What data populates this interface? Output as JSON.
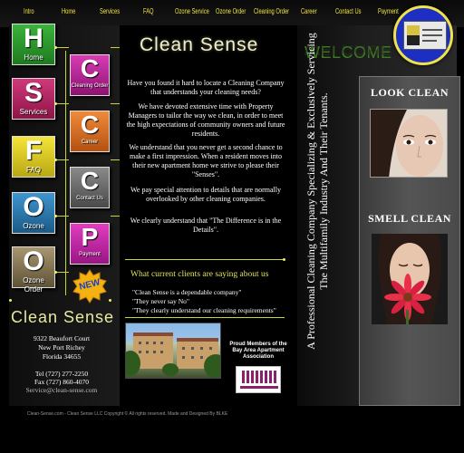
{
  "nav": {
    "items": [
      {
        "label": "Intro"
      },
      {
        "label": "Home"
      },
      {
        "label": "Services"
      },
      {
        "label": "FAQ"
      },
      {
        "label": "Ozone Service"
      },
      {
        "label": "Ozone Order"
      },
      {
        "label": "Cleaning Order"
      },
      {
        "label": "Career"
      },
      {
        "label": "Contact Us"
      },
      {
        "label": "Payment"
      }
    ]
  },
  "tiles": {
    "home": {
      "letter": "H",
      "label": "Home",
      "color": "#2a9a2a"
    },
    "cleaning_order": {
      "letter": "C",
      "label": "Cleaning Order",
      "color": "#b01f8f"
    },
    "services": {
      "letter": "S",
      "label": "Services",
      "color": "#b2205e"
    },
    "career": {
      "letter": "C",
      "label": "Career",
      "color": "#d86a1c"
    },
    "faq": {
      "letter": "F",
      "label": "FAQ",
      "color": "#e4d21a"
    },
    "contact_us": {
      "letter": "C",
      "label": "Contact Us",
      "color": "#6a6a6a"
    },
    "ozone": {
      "letter": "O",
      "label": "Ozone",
      "color": "#2a7bb0"
    },
    "payment": {
      "letter": "P",
      "label": "Payment",
      "color": "#c11f9a"
    },
    "ozone_order": {
      "letter": "O",
      "label": "Ozone Order",
      "color": "#8a7a52"
    },
    "new_badge": {
      "label": "NEW"
    }
  },
  "brand": {
    "name": "Clean Sense"
  },
  "contact": {
    "address_line1": "9322 Beaufort Court",
    "address_line2": "New Port Richey",
    "address_line3": "Florida 34655",
    "tel": "Tel (727) 277-2250",
    "fax": "Fax (727) 860-4070",
    "email": "Service@clean-sense.com"
  },
  "main": {
    "paragraphs": [
      "Have you found it hard to locate a Cleaning Company that understands your cleaning needs?",
      "We have devoted extensive time with Property Managers to tailor the way we clean, in order to meet the high expectations of community owners and future residents.",
      "We understand that you never get a second chance to make a first impression. When a resident moves into their new apartment home we strive to please their \"Senses\".",
      "We pay special attention to details that are normally overlooked by other cleaning companies.",
      "We clearly understand that \"The Difference is in the Details\"."
    ],
    "clients_heading": "What current clients are saying about us",
    "quotes": [
      "\"Clean Sense is a dependable company\"",
      "\"They never say No\"",
      "\"They clearly understand our cleaning requirements\""
    ],
    "member_text": "Proud Members of the Bay Area Apartment Association"
  },
  "right": {
    "welcome": "WELCOME",
    "vertical_text": "A Professional Cleaning Company Specializing & Exclusively Servicing The Multifamily Industry And Their Tenants.",
    "look_clean": "LOOK CLEAN",
    "smell_clean": "SMELL CLEAN"
  },
  "footer": {
    "text": "Clean-Sense.com - Clean Sense LLC Copyright © All rights reserved. Made and Designed By BLKE"
  },
  "colors": {
    "accent_yellow": "#f2e13c",
    "welcome_green": "#3c7d22"
  }
}
